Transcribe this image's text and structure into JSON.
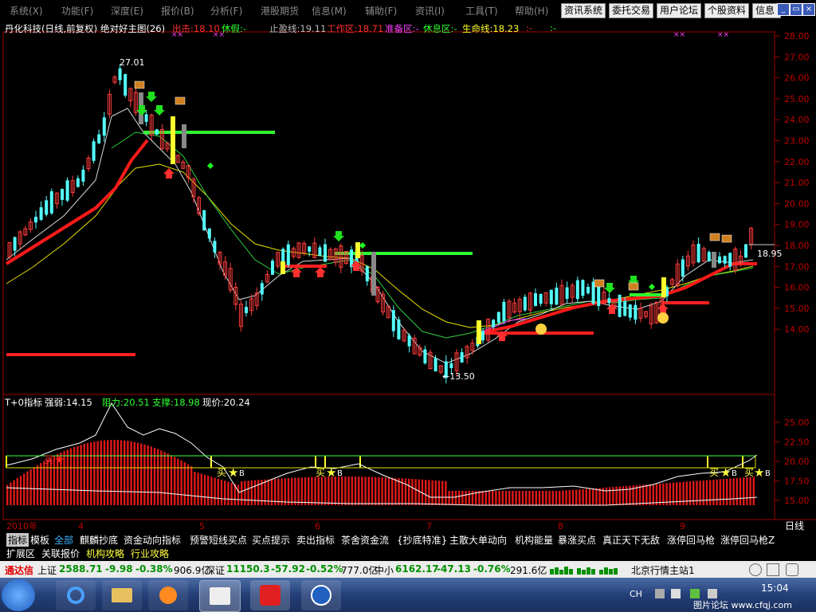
{
  "menu": {
    "items": [
      "系统(X)",
      "功能(F)",
      "深度(E)",
      "报价(B)",
      "分析(F)",
      "港股期货",
      "信息(M)",
      "辅助(F)",
      "资讯(I)",
      "工具(T)",
      "帮助(H)"
    ],
    "buttons": [
      "资讯系统",
      "委托交易",
      "用户论坛",
      "个股资料",
      "信息"
    ]
  },
  "chart_info": {
    "stock": "丹化科技(日线,前复权)",
    "indicator": "绝对好主图(26)",
    "chuji": "出击:18.10",
    "xiujia": "休假:-",
    "zhiying": "止盈线:19.11",
    "gongzuo": "工作区:18.71",
    "zhunbei": "准备区:-",
    "xiuxi": "休息区:-",
    "shengming": "生命线:18.23",
    "tail": ":-",
    "dash": ":-"
  },
  "price_axis": [
    "28.00",
    "27.00",
    "26.00",
    "25.00",
    "24.00",
    "23.00",
    "22.00",
    "21.00",
    "20.00",
    "19.00",
    "18.00",
    "17.00",
    "16.00",
    "15.00",
    "14.00"
  ],
  "price_labels": {
    "high": "27.01",
    "low": "←13.50",
    "last": "18.95"
  },
  "sub_info": {
    "name": "T+0指标",
    "strength": "强弱:14.15",
    "resist": "阻力:20.51",
    "support": "支撑:18.98",
    "current": "现价:20.24"
  },
  "sub_axis": [
    "25.00",
    "22.50",
    "20.00",
    "17.50",
    "15.00"
  ],
  "sub_marks": [
    "买",
    "买",
    "买",
    "买",
    "买"
  ],
  "sub_b": [
    "B",
    "B",
    "B",
    "B"
  ],
  "date_axis": [
    "2010年",
    "4",
    "5",
    "6",
    "7",
    "8",
    "9"
  ],
  "period_label": "日线",
  "tabs_row1": [
    "指标",
    "模板",
    "全部",
    "麒麟抄底",
    "资金动向指标",
    "预警短线买点",
    "买点提示",
    "卖出指标",
    "茶舍资金流",
    "{抄底特准}",
    "主散大单动向",
    "机构能量",
    "暴涨买点",
    "真正天下无敌",
    "涨停回马枪",
    "涨停回马枪Z"
  ],
  "tabs_row2": [
    "扩展区",
    "关联报价",
    "机构攻略",
    "行业攻略"
  ],
  "status": {
    "brand": "通达信",
    "sh_name": "上证",
    "sh_value": "2588.71",
    "sh_change": "-9.98",
    "sh_pct": "-0.38%",
    "sh_amount": "906.9亿",
    "sz_name": "深证",
    "sz_value": "11150.3",
    "sz_change": "-57.92",
    "sz_pct": "-0.52%",
    "sz_amount": "777.0亿",
    "zx_name": "中小",
    "zx_value": "6162.17",
    "zx_change": "-47.13",
    "zx_pct": "-0.76%",
    "zx_amount": "291.6亿",
    "server": "北京行情主站1"
  },
  "taskbar": {
    "lang": "CH",
    "time": "15:04",
    "watermark": "图片论坛 www.cfqj.com"
  },
  "colors": {
    "up": "#ff3c3c",
    "down": "#54ffff",
    "axis_red": "#c00000",
    "green_line": "#00ff00",
    "yellow": "#ffff00"
  }
}
